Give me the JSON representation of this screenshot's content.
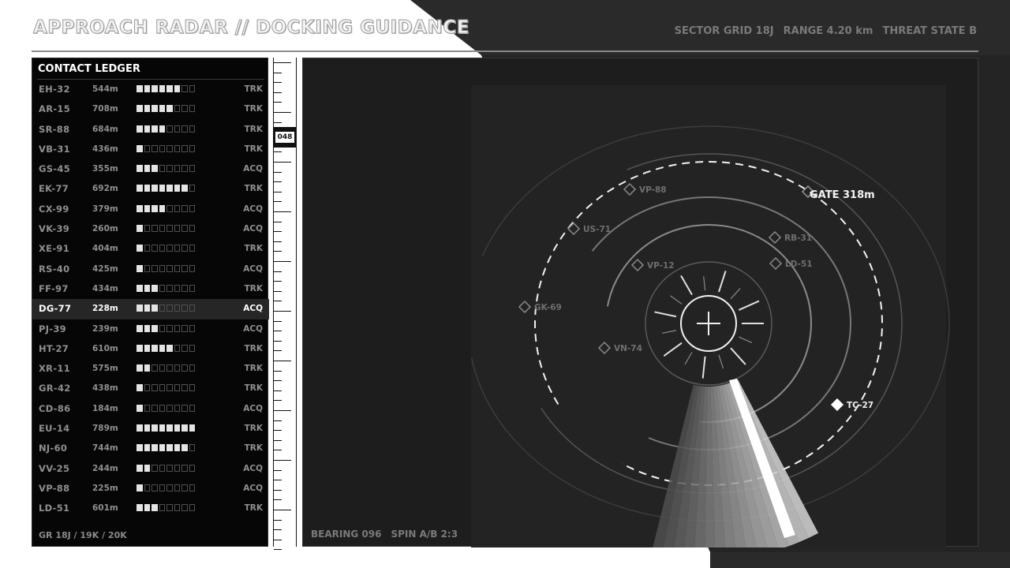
{
  "header": {
    "title": "APPROACH RADAR // DOCKING GUIDANCE",
    "sector": "SECTOR GRID 18J",
    "range": "RANGE 4.20 km",
    "threat": "THREAT STATE B"
  },
  "ledger": {
    "title": "CONTACT LEDGER",
    "footer": "GR 18J / 19K / 20K",
    "selected_index": 11,
    "contacts": [
      {
        "id": "EH-32",
        "range": "544m",
        "level": 6,
        "status": "TRK"
      },
      {
        "id": "AR-15",
        "range": "708m",
        "level": 5,
        "status": "TRK"
      },
      {
        "id": "SR-88",
        "range": "684m",
        "level": 4,
        "status": "TRK"
      },
      {
        "id": "VB-31",
        "range": "436m",
        "level": 1,
        "status": "TRK"
      },
      {
        "id": "GS-45",
        "range": "355m",
        "level": 3,
        "status": "ACQ"
      },
      {
        "id": "EK-77",
        "range": "692m",
        "level": 7,
        "status": "TRK"
      },
      {
        "id": "CX-99",
        "range": "379m",
        "level": 4,
        "status": "ACQ"
      },
      {
        "id": "VK-39",
        "range": "260m",
        "level": 1,
        "status": "ACQ"
      },
      {
        "id": "XE-91",
        "range": "404m",
        "level": 1,
        "status": "TRK"
      },
      {
        "id": "RS-40",
        "range": "425m",
        "level": 1,
        "status": "ACQ"
      },
      {
        "id": "FF-97",
        "range": "434m",
        "level": 3,
        "status": "TRK"
      },
      {
        "id": "DG-77",
        "range": "228m",
        "level": 3,
        "status": "ACQ"
      },
      {
        "id": "PJ-39",
        "range": "239m",
        "level": 3,
        "status": "ACQ"
      },
      {
        "id": "HT-27",
        "range": "610m",
        "level": 5,
        "status": "TRK"
      },
      {
        "id": "XR-11",
        "range": "575m",
        "level": 2,
        "status": "TRK"
      },
      {
        "id": "GR-42",
        "range": "438m",
        "level": 1,
        "status": "TRK"
      },
      {
        "id": "CD-86",
        "range": "184m",
        "level": 1,
        "status": "ACQ"
      },
      {
        "id": "EU-14",
        "range": "789m",
        "level": 8,
        "status": "TRK"
      },
      {
        "id": "NJ-60",
        "range": "744m",
        "level": 7,
        "status": "TRK"
      },
      {
        "id": "VV-25",
        "range": "244m",
        "level": 2,
        "status": "ACQ"
      },
      {
        "id": "VP-88",
        "range": "225m",
        "level": 1,
        "status": "ACQ"
      },
      {
        "id": "LD-51",
        "range": "601m",
        "level": 3,
        "status": "TRK"
      }
    ],
    "bar_cells": 8
  },
  "scale": {
    "bearing_tag": "048"
  },
  "radar": {
    "footer_bearing": "BEARING 096",
    "footer_spin": "SPIN A/B 2:3",
    "gate_label": "GATE 318m",
    "sweep_angle_deg": 160,
    "blips": [
      {
        "id": "VP-88",
        "highlight": false
      },
      {
        "id": "US-71",
        "highlight": false
      },
      {
        "id": "RB-31",
        "highlight": false
      },
      {
        "id": "LD-51",
        "highlight": false
      },
      {
        "id": "VP-12",
        "highlight": false
      },
      {
        "id": "GK-69",
        "highlight": false
      },
      {
        "id": "VN-74",
        "highlight": false
      },
      {
        "id": "TC-27",
        "highlight": true
      }
    ]
  },
  "colors": {
    "panel_dark": "#060606",
    "radar_bg": "#1d1d1d",
    "accent_light": "#f0f0f0",
    "muted": "#7a7a7a"
  }
}
